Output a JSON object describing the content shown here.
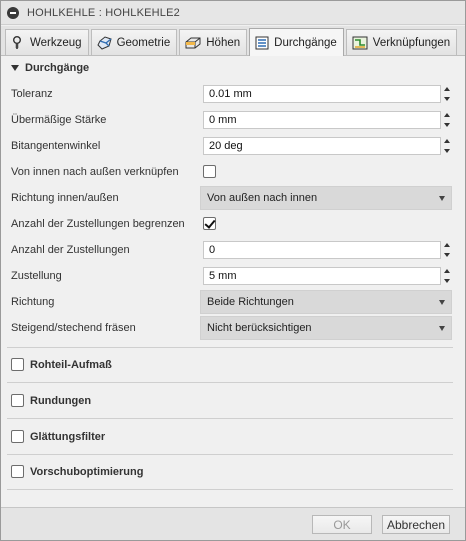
{
  "window": {
    "title": "HOHLKEHLE : HOHLKEHLE2"
  },
  "tabs": [
    {
      "label": "Werkzeug",
      "icon": "tool-icon"
    },
    {
      "label": "Geometrie",
      "icon": "geometry-icon"
    },
    {
      "label": "Höhen",
      "icon": "heights-icon"
    },
    {
      "label": "Durchgänge",
      "icon": "passes-icon",
      "active": true
    },
    {
      "label": "Verknüpfungen",
      "icon": "linking-icon"
    }
  ],
  "section": {
    "title": "Durchgänge"
  },
  "fields": {
    "toleranz": {
      "label": "Toleranz",
      "value": "0.01 mm"
    },
    "uebermass": {
      "label": "Übermäßige Stärke",
      "value": "0 mm"
    },
    "bitangent": {
      "label": "Bitangentenwinkel",
      "value": "20 deg"
    },
    "innen_aussen": {
      "label": "Von innen nach außen verknüpfen",
      "checked": false
    },
    "richtung_io": {
      "label": "Richtung innen/außen",
      "value": "Von außen nach innen"
    },
    "anzahl_begrenzen": {
      "label": "Anzahl der Zustellungen begrenzen",
      "checked": true
    },
    "anzahl": {
      "label": "Anzahl der Zustellungen",
      "value": "0"
    },
    "zustellung": {
      "label": "Zustellung",
      "value": "5 mm"
    },
    "richtung": {
      "label": "Richtung",
      "value": "Beide Richtungen"
    },
    "steigend": {
      "label": "Steigend/stechend fräsen",
      "value": "Nicht berücksichtigen"
    }
  },
  "collapsed_sections": [
    {
      "label": "Rohteil-Aufmaß"
    },
    {
      "label": "Rundungen"
    },
    {
      "label": "Glättungsfilter"
    },
    {
      "label": "Vorschuboptimierung"
    }
  ],
  "footer": {
    "ok_label": "OK",
    "cancel_label": "Abbrechen"
  }
}
